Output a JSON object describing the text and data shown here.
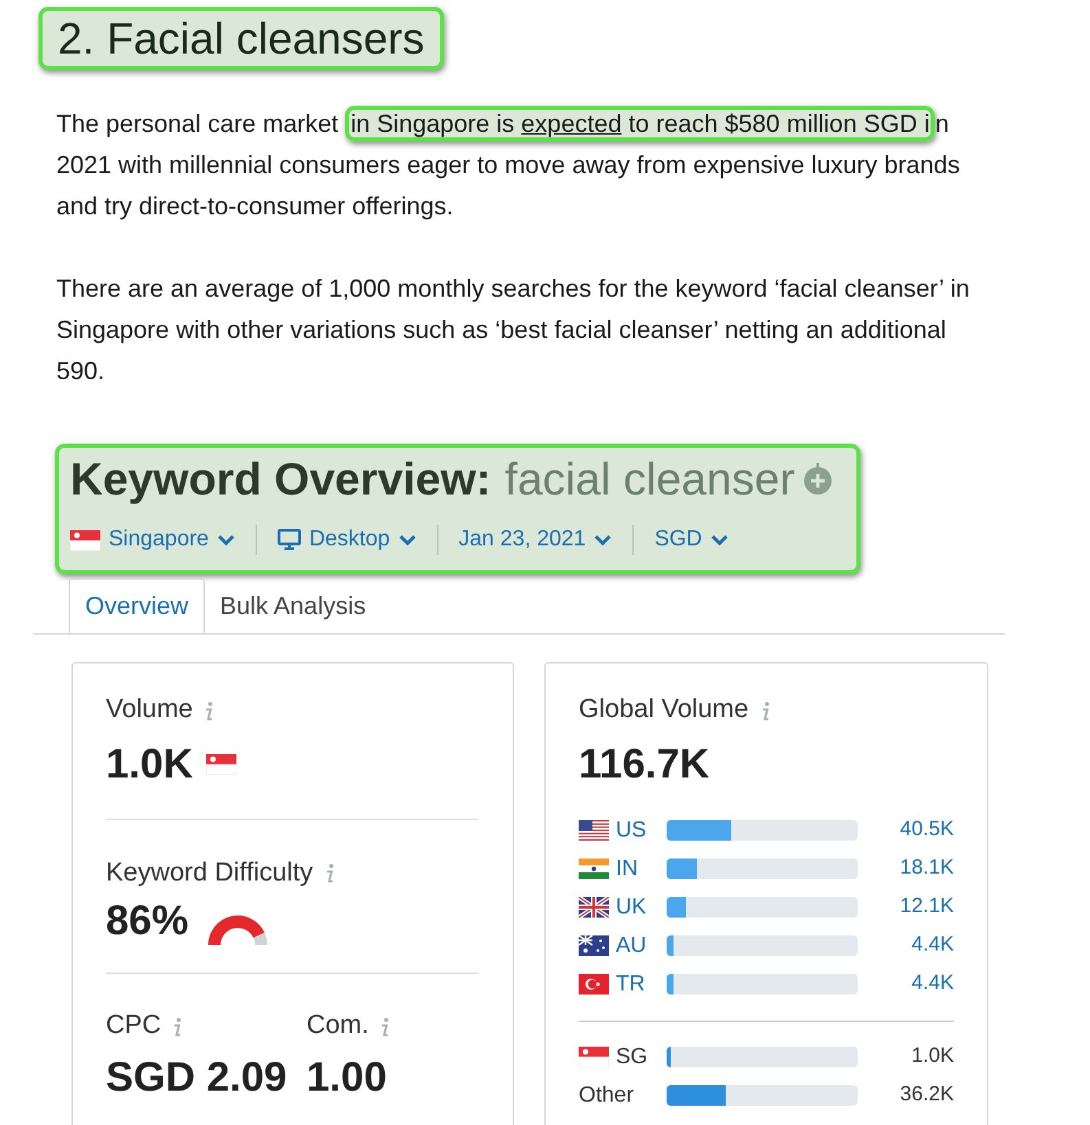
{
  "heading": {
    "text": "2. Facial cleansers",
    "highlighted": true
  },
  "paragraphs": [
    {
      "before": "The personal care market ",
      "highlight_start": "in Singapore is ",
      "link": "expected",
      "highlight_end": " to reach $580 million SGD i",
      "after": "n 2021 with millennial consumers eager to move away from expensive luxury brands and try direct-to-consumer offerings."
    },
    {
      "before": "There are an average of 1,000 monthly searches for the keyword ‘facial cleanser’ in Singapore with other variations such as ‘best facial cleanser’ netting an additional 590."
    }
  ],
  "keyword_overview": {
    "title": "Keyword Overview:",
    "keyword": "facial cleanser",
    "highlighted": true,
    "filters": [
      {
        "kind": "flag",
        "label": "Singapore"
      },
      {
        "kind": "device",
        "label": "Desktop"
      },
      {
        "kind": "plain",
        "label": "Jan 23, 2021"
      },
      {
        "kind": "plain",
        "label": "SGD"
      }
    ]
  },
  "tabs": [
    {
      "label": "Overview",
      "selected": true
    },
    {
      "label": "Bulk Analysis",
      "selected": false
    }
  ],
  "metrics": {
    "volume": {
      "label": "Volume",
      "value": "1.0K"
    },
    "difficulty": {
      "label": "Keyword Difficulty",
      "value": "86%"
    },
    "cpc": {
      "label": "CPC",
      "value": "SGD 2.09"
    },
    "competition": {
      "label": "Com.",
      "value": "1.00"
    }
  },
  "global_volume": {
    "label": "Global Volume",
    "value": "116.7K",
    "countries": [
      {
        "kind": "us",
        "code": "US",
        "value": "40.5K",
        "level": 0.34,
        "linked": true
      },
      {
        "kind": "in",
        "code": "IN",
        "value": "18.1K",
        "level": 0.155,
        "linked": true
      },
      {
        "kind": "uk",
        "code": "UK",
        "value": "12.1K",
        "level": 0.1,
        "linked": true
      },
      {
        "kind": "au",
        "code": "AU",
        "value": "4.4K",
        "level": 0.035,
        "linked": true
      },
      {
        "kind": "tr",
        "code": "TR",
        "value": "4.4K",
        "level": 0.035,
        "linked": true
      }
    ],
    "others": [
      {
        "kind": "sg",
        "code": "SG",
        "value": "1.0K",
        "level": 0.02,
        "linked": false
      },
      {
        "kind": "other",
        "code": "Other",
        "value": "36.2K",
        "level": 0.31,
        "linked": false
      }
    ]
  }
}
